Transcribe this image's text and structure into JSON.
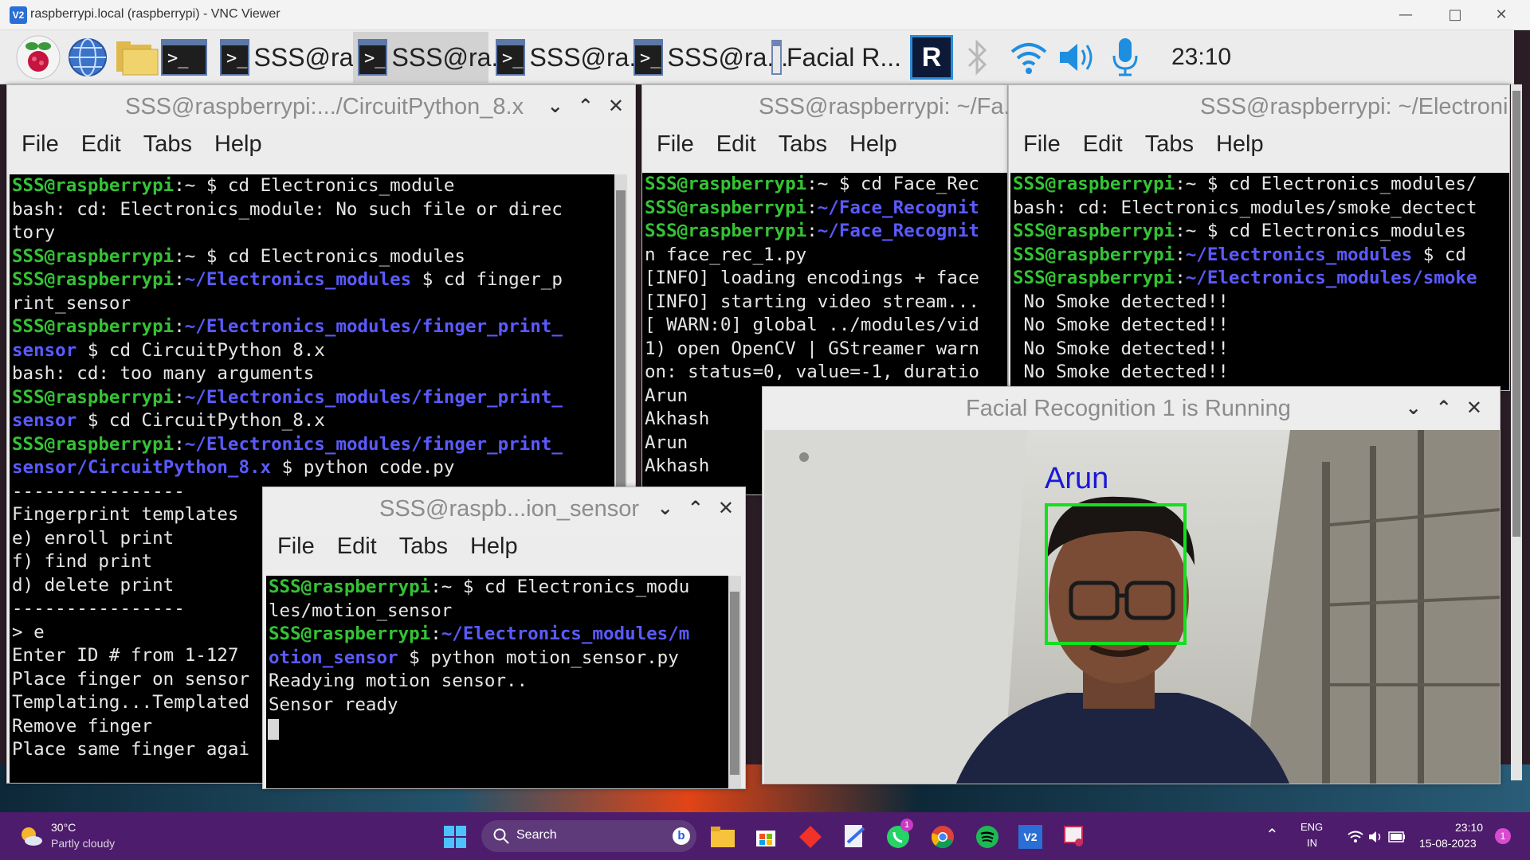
{
  "vnc": {
    "logo": "V2",
    "title": "raspberrypi.local (raspberrypi) - VNC Viewer"
  },
  "pi_taskbar": {
    "tasks": [
      {
        "label": "SSS@ra..."
      },
      {
        "label": "SSS@ra..."
      },
      {
        "label": "SSS@ra..."
      },
      {
        "label": "SSS@ra..."
      },
      {
        "label": "Facial R..."
      }
    ],
    "clock": "23:10"
  },
  "windows": {
    "circuit": {
      "title": "SSS@raspberrypi:.../CircuitPython_8.x",
      "lines": [
        [
          {
            "t": "SSS@raspberrypi",
            "c": "g"
          },
          {
            "t": ":~ $ cd Electronics_module",
            "c": ""
          }
        ],
        [
          {
            "t": "bash: cd: Electronics_module: No such file or direc",
            "c": ""
          }
        ],
        [
          {
            "t": "tory",
            "c": ""
          }
        ],
        [
          {
            "t": "SSS@raspberrypi",
            "c": "g"
          },
          {
            "t": ":~ $ cd Electronics_modules",
            "c": ""
          }
        ],
        [
          {
            "t": "SSS@raspberrypi",
            "c": "g"
          },
          {
            "t": ":",
            "c": ""
          },
          {
            "t": "~/Electronics_modules",
            "c": "b"
          },
          {
            "t": " $ cd finger_p",
            "c": ""
          }
        ],
        [
          {
            "t": "rint_sensor",
            "c": ""
          }
        ],
        [
          {
            "t": "SSS@raspberrypi",
            "c": "g"
          },
          {
            "t": ":",
            "c": ""
          },
          {
            "t": "~/Electronics_modules/finger_print_",
            "c": "b"
          }
        ],
        [
          {
            "t": "sensor",
            "c": "b"
          },
          {
            "t": " $ cd CircuitPython 8.x",
            "c": ""
          }
        ],
        [
          {
            "t": "bash: cd: too many arguments",
            "c": ""
          }
        ],
        [
          {
            "t": "SSS@raspberrypi",
            "c": "g"
          },
          {
            "t": ":",
            "c": ""
          },
          {
            "t": "~/Electronics_modules/finger_print_",
            "c": "b"
          }
        ],
        [
          {
            "t": "sensor",
            "c": "b"
          },
          {
            "t": " $ cd CircuitPython_8.x",
            "c": ""
          }
        ],
        [
          {
            "t": "SSS@raspberrypi",
            "c": "g"
          },
          {
            "t": ":",
            "c": ""
          },
          {
            "t": "~/Electronics_modules/finger_print_",
            "c": "b"
          }
        ],
        [
          {
            "t": "sensor/CircuitPython_8.x",
            "c": "b"
          },
          {
            "t": " $ python code.py",
            "c": ""
          }
        ],
        [
          {
            "t": "----------------",
            "c": ""
          }
        ],
        [
          {
            "t": "Fingerprint templates",
            "c": ""
          }
        ],
        [
          {
            "t": "e) enroll print",
            "c": ""
          }
        ],
        [
          {
            "t": "f) find print",
            "c": ""
          }
        ],
        [
          {
            "t": "d) delete print",
            "c": ""
          }
        ],
        [
          {
            "t": "----------------",
            "c": ""
          }
        ],
        [
          {
            "t": "> e",
            "c": ""
          }
        ],
        [
          {
            "t": "Enter ID # from 1-127",
            "c": ""
          }
        ],
        [
          {
            "t": "Place finger on sensor",
            "c": ""
          }
        ],
        [
          {
            "t": "Templating...Templated",
            "c": ""
          }
        ],
        [
          {
            "t": "Remove finger",
            "c": ""
          }
        ],
        [
          {
            "t": "Place same finger agai",
            "c": ""
          }
        ]
      ]
    },
    "face": {
      "title": "SSS@raspberrypi: ~/Fa...",
      "lines": [
        [
          {
            "t": "SSS@raspberrypi",
            "c": "g"
          },
          {
            "t": ":~ $ cd Face_Rec",
            "c": ""
          }
        ],
        [
          {
            "t": "SSS@raspberrypi",
            "c": "g"
          },
          {
            "t": ":",
            "c": ""
          },
          {
            "t": "~/Face_Recognit",
            "c": "b"
          }
        ],
        [
          {
            "t": "SSS@raspberrypi",
            "c": "g"
          },
          {
            "t": ":",
            "c": ""
          },
          {
            "t": "~/Face_Recognit",
            "c": "b"
          }
        ],
        [
          {
            "t": "n face_rec_1.py",
            "c": ""
          }
        ],
        [
          {
            "t": "[INFO] loading encodings + face",
            "c": ""
          }
        ],
        [
          {
            "t": "[INFO] starting video stream...",
            "c": ""
          }
        ],
        [
          {
            "t": "[ WARN:0] global ../modules/vid",
            "c": ""
          }
        ],
        [
          {
            "t": "1) open OpenCV | GStreamer warn",
            "c": ""
          }
        ],
        [
          {
            "t": "on: status=0, value=-1, duratio",
            "c": ""
          }
        ],
        [
          {
            "t": "Arun",
            "c": ""
          }
        ],
        [
          {
            "t": "Akhash",
            "c": ""
          }
        ],
        [
          {
            "t": "Arun",
            "c": ""
          }
        ],
        [
          {
            "t": "Akhash",
            "c": ""
          }
        ]
      ]
    },
    "smoke": {
      "title": "SSS@raspberrypi: ~/Electroni",
      "lines": [
        [
          {
            "t": "SSS@raspberrypi",
            "c": "g"
          },
          {
            "t": ":~ $ cd Electronics_modules/",
            "c": ""
          }
        ],
        [
          {
            "t": "bash: cd: Electronics_modules/smoke_dectect",
            "c": ""
          }
        ],
        [
          {
            "t": "SSS@raspberrypi",
            "c": "g"
          },
          {
            "t": ":~ $ cd Electronics_modules",
            "c": ""
          }
        ],
        [
          {
            "t": "SSS@raspberrypi",
            "c": "g"
          },
          {
            "t": ":",
            "c": ""
          },
          {
            "t": "~/Electronics_modules",
            "c": "b"
          },
          {
            "t": " $ cd",
            "c": ""
          }
        ],
        [
          {
            "t": "SSS@raspberrypi",
            "c": "g"
          },
          {
            "t": ":",
            "c": ""
          },
          {
            "t": "~/Electronics_modules/smoke",
            "c": "b"
          }
        ],
        [
          {
            "t": " No Smoke detected!!",
            "c": ""
          }
        ],
        [
          {
            "t": " No Smoke detected!!",
            "c": ""
          }
        ],
        [
          {
            "t": " No Smoke detected!!",
            "c": ""
          }
        ],
        [
          {
            "t": " No Smoke detected!!",
            "c": ""
          }
        ]
      ]
    },
    "motion": {
      "title": "SSS@raspb...ion_sensor",
      "lines": [
        [
          {
            "t": "SSS@raspberrypi",
            "c": "g"
          },
          {
            "t": ":~ $ cd Electronics_modu",
            "c": ""
          }
        ],
        [
          {
            "t": "les/motion_sensor",
            "c": ""
          }
        ],
        [
          {
            "t": "SSS@raspberrypi",
            "c": "g"
          },
          {
            "t": ":",
            "c": ""
          },
          {
            "t": "~/Electronics_modules/m",
            "c": "b"
          }
        ],
        [
          {
            "t": "otion_sensor",
            "c": "b"
          },
          {
            "t": " $ python motion_sensor.py",
            "c": ""
          }
        ],
        [
          {
            "t": "Readying motion sensor..",
            "c": ""
          }
        ],
        [
          {
            "t": "Sensor ready",
            "c": ""
          }
        ]
      ]
    },
    "facial": {
      "title": "Facial Recognition 1 is Running",
      "detected_name": "Arun"
    }
  },
  "menu": {
    "file": "File",
    "edit": "Edit",
    "tabs": "Tabs",
    "help": "Help"
  },
  "windows_taskbar": {
    "weather_temp": "30°C",
    "weather_desc": "Partly cloudy",
    "search_label": "Search",
    "lang_top": "ENG",
    "lang_bottom": "IN",
    "time": "23:10",
    "date": "15-08-2023",
    "whatsapp_badge": "1",
    "notification_badge": "1"
  }
}
